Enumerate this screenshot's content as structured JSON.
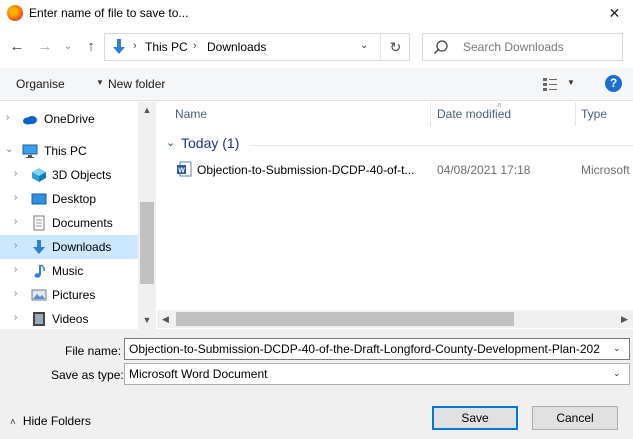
{
  "window": {
    "title": "Enter name of file to save to...",
    "close_glyph": "✕"
  },
  "nav": {
    "back_glyph": "←",
    "forward_glyph": "→",
    "recent_glyph": "⌄",
    "up_glyph": "↑",
    "breadcrumbs": [
      "This PC",
      "Downloads"
    ],
    "crumb_sep": "›",
    "dropdown_glyph": "⌄",
    "refresh_glyph": "↻"
  },
  "search": {
    "placeholder": "Search Downloads"
  },
  "toolbar": {
    "organise_label": "Organise",
    "caret_glyph": "▼",
    "new_folder_label": "New folder",
    "help_glyph": "?"
  },
  "sidebar": {
    "items": [
      {
        "label": "OneDrive",
        "icon": "onedrive-icon",
        "indent": 0
      },
      {
        "label": "This PC",
        "icon": "this-pc-icon",
        "indent": 0,
        "expanded": true
      },
      {
        "label": "3D Objects",
        "icon": "3d-objects-icon",
        "indent": 1
      },
      {
        "label": "Desktop",
        "icon": "desktop-icon",
        "indent": 1
      },
      {
        "label": "Documents",
        "icon": "documents-icon",
        "indent": 1
      },
      {
        "label": "Downloads",
        "icon": "downloads-icon",
        "indent": 1,
        "selected": true
      },
      {
        "label": "Music",
        "icon": "music-icon",
        "indent": 1
      },
      {
        "label": "Pictures",
        "icon": "pictures-icon",
        "indent": 1
      },
      {
        "label": "Videos",
        "icon": "videos-icon",
        "indent": 1
      }
    ],
    "chevron_right": "›",
    "chevron_down": "⌄",
    "scroll_up_glyph": "▲",
    "scroll_down_glyph": "▼"
  },
  "file_list": {
    "columns": [
      "Name",
      "Date modified",
      "Type"
    ],
    "sort_glyph": "˄",
    "group": {
      "label": "Today (1)",
      "chevron": "⌄"
    },
    "files": [
      {
        "name": "Objection-to-Submission-DCDP-40-of-t...",
        "date_modified": "04/08/2021 17:18",
        "type": "Microsoft"
      }
    ],
    "hscroll_left_glyph": "◀",
    "hscroll_right_glyph": "▶"
  },
  "form": {
    "file_name_label": "File name:",
    "file_name_value": "Objection-to-Submission-DCDP-40-of-the-Draft-Longford-County-Development-Plan-202",
    "save_type_label": "Save as type:",
    "save_type_value": "Microsoft Word Document",
    "dropdown_glyph": "⌄",
    "hide_folders_label": "Hide Folders",
    "hide_folders_glyph": "˄",
    "save_label": "Save",
    "cancel_label": "Cancel"
  },
  "colors": {
    "accent": "#0078d7",
    "selection": "#cce8ff",
    "group_header": "#1e3287",
    "column_header": "#4c607a",
    "help": "#1a6fd1"
  }
}
